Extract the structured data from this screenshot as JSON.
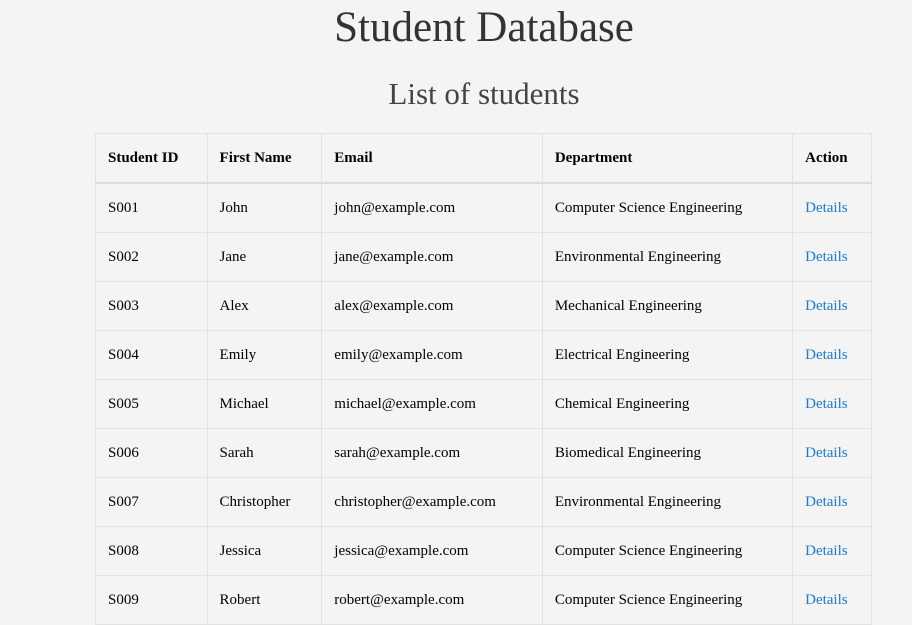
{
  "page": {
    "title": "Student Database",
    "subtitle": "List of students"
  },
  "table": {
    "headers": {
      "student_id": "Student ID",
      "first_name": "First Name",
      "email": "Email",
      "department": "Department",
      "action": "Action"
    },
    "rows": [
      {
        "student_id": "S001",
        "first_name": "John",
        "email": "john@example.com",
        "department": "Computer Science Engineering",
        "action": "Details"
      },
      {
        "student_id": "S002",
        "first_name": "Jane",
        "email": "jane@example.com",
        "department": "Environmental Engineering",
        "action": "Details"
      },
      {
        "student_id": "S003",
        "first_name": "Alex",
        "email": "alex@example.com",
        "department": "Mechanical Engineering",
        "action": "Details"
      },
      {
        "student_id": "S004",
        "first_name": "Emily",
        "email": "emily@example.com",
        "department": "Electrical Engineering",
        "action": "Details"
      },
      {
        "student_id": "S005",
        "first_name": "Michael",
        "email": "michael@example.com",
        "department": "Chemical Engineering",
        "action": "Details"
      },
      {
        "student_id": "S006",
        "first_name": "Sarah",
        "email": "sarah@example.com",
        "department": "Biomedical Engineering",
        "action": "Details"
      },
      {
        "student_id": "S007",
        "first_name": "Christopher",
        "email": "christopher@example.com",
        "department": "Environmental Engineering",
        "action": "Details"
      },
      {
        "student_id": "S008",
        "first_name": "Jessica",
        "email": "jessica@example.com",
        "department": "Computer Science Engineering",
        "action": "Details"
      },
      {
        "student_id": "S009",
        "first_name": "Robert",
        "email": "robert@example.com",
        "department": "Computer Science Engineering",
        "action": "Details"
      }
    ]
  },
  "colors": {
    "background": "#f4f4f4",
    "link": "#1a7ad9",
    "border": "#e2e2e2"
  }
}
